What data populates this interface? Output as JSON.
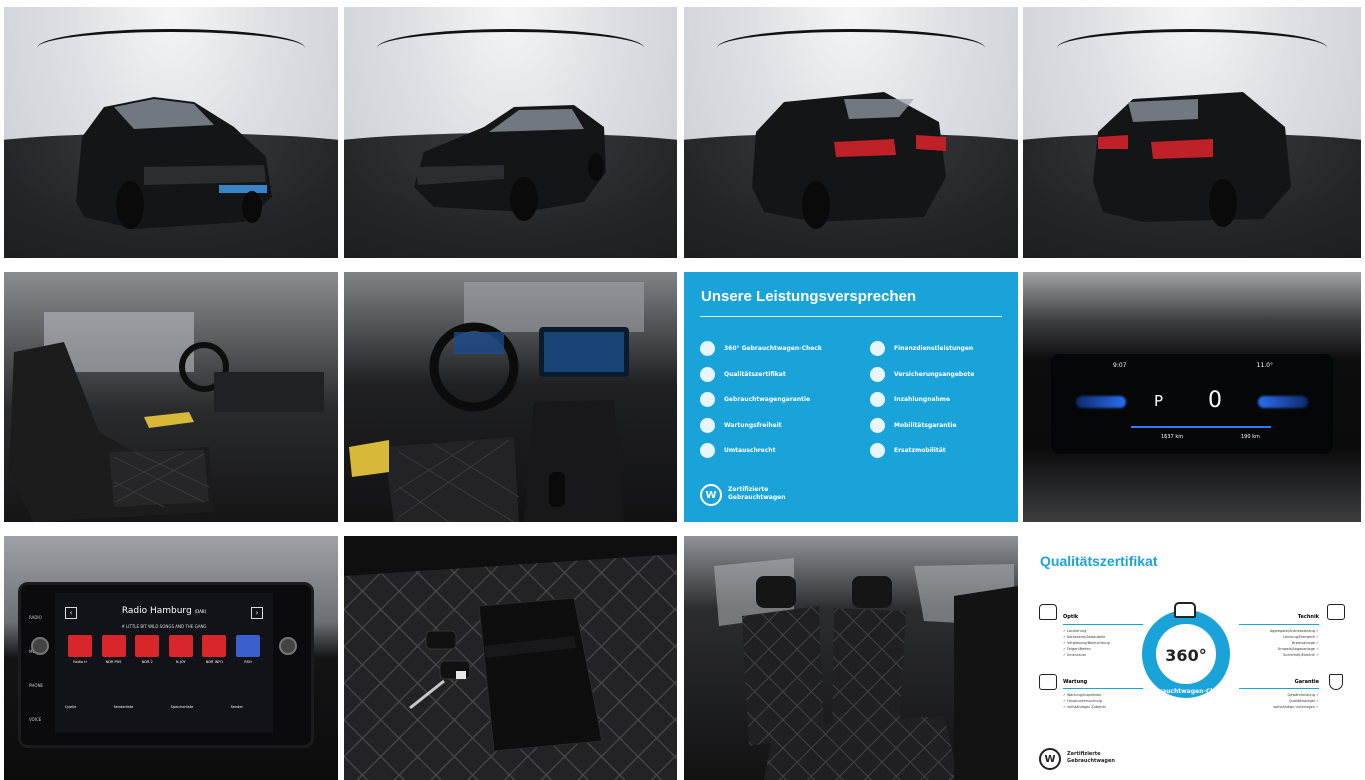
{
  "gallery": {
    "photos": [
      {
        "name": "car-front-left"
      },
      {
        "name": "car-front-right"
      },
      {
        "name": "car-rear-left"
      },
      {
        "name": "car-rear-right"
      },
      {
        "name": "interior-driver-seat"
      },
      {
        "name": "interior-cockpit"
      },
      {
        "name": "promise-card"
      },
      {
        "name": "instrument-cluster"
      },
      {
        "name": "infotainment-screen"
      },
      {
        "name": "keys-and-manual"
      },
      {
        "name": "rear-seats"
      },
      {
        "name": "quality-certificate"
      }
    ]
  },
  "promise": {
    "title": "Unsere Leistungsversprechen",
    "left_items": [
      "360° Gebrauchtwagen-Check",
      "Qualitätszertifikat",
      "Gebrauchtwagengarantie",
      "Wartungsfreiheit",
      "Umtauschrecht"
    ],
    "right_items": [
      "Finanzdienstleistungen",
      "Versicherungsangebote",
      "Inzahlungnahme",
      "Mobilitätsgarantie",
      "Ersatzmobilität"
    ],
    "brand_line1": "Zertifizierte",
    "brand_line2": "Gebrauchtwagen",
    "accent": "#1aa3d9"
  },
  "cluster": {
    "time": "9:07",
    "temp": "11.0°",
    "gear": "P",
    "speed": "0",
    "range": "1637 km",
    "fuel": "190 km"
  },
  "radio": {
    "station": "Radio Hamburg",
    "station_suffix": "(DAB)",
    "text": "# LITTLE BIT WILD SONGS AND THE GANG",
    "menu_left": [
      "RADIO",
      "MEDIA",
      "PHONE",
      "VOICE"
    ],
    "presets": [
      "Radio H",
      "NDR PHS",
      "NDR 2",
      "N-JOY",
      "NDR INFO",
      "RSH"
    ],
    "bottom": [
      "Quelle",
      "Senderliste",
      "Speicherliste",
      "Sender"
    ]
  },
  "certificate": {
    "title": "Qualitätszertifikat",
    "optik": "Optik",
    "optik_items": [
      "Lackierung",
      "Karosserie/Anbauteile",
      "Verglasung/Beleuchtung",
      "Felgen/Reifen",
      "Innenraum"
    ],
    "wartung": "Wartung",
    "wartung_items": [
      "Wartung/Inspektion",
      "Hauptuntersuchung",
      "vollständiges Zubehör"
    ],
    "technik": "Technik",
    "technik_items": [
      "Aggregate/Antriebsstrang",
      "Lenkung/Fahrwerk",
      "Bremsanlage",
      "Umwelt/Abgasanlage",
      "Sicherheit/Elektrik"
    ],
    "garantie": "Garantie",
    "garantie_items": [
      "Gewährleistung",
      "Qualitätssiegel",
      "vollständige Unterlagen"
    ],
    "badge_number": "360°",
    "badge_ring": "Gebrauchtwagen-Check",
    "brand_line1": "Zertifizierte",
    "brand_line2": "Gebrauchtwagen",
    "accent": "#1aa3d9"
  }
}
